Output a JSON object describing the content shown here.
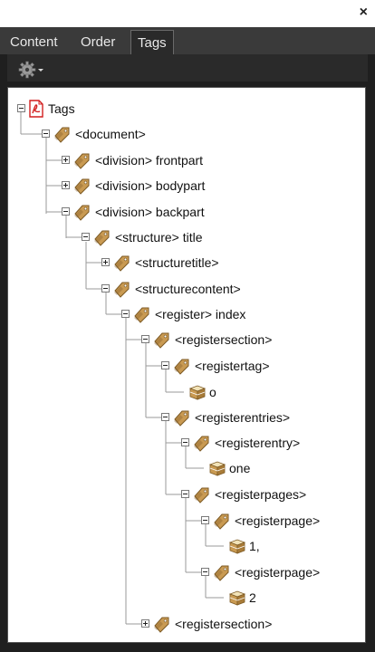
{
  "tabs": [
    {
      "label": "Content"
    },
    {
      "label": "Order"
    },
    {
      "label": "Tags"
    }
  ],
  "active_tab": "Tags",
  "close_glyph": "×",
  "tree": [
    {
      "label": "Tags",
      "icon": "pdf-icon",
      "exp": "minus"
    },
    {
      "label": "<document>",
      "icon": "tag-icon",
      "exp": "minus"
    },
    {
      "label": "<division> frontpart",
      "icon": "tag-icon",
      "exp": "plus"
    },
    {
      "label": "<division> bodypart",
      "icon": "tag-icon",
      "exp": "plus"
    },
    {
      "label": "<division> backpart",
      "icon": "tag-icon",
      "exp": "minus"
    },
    {
      "label": "<structure> title",
      "icon": "tag-icon",
      "exp": "minus"
    },
    {
      "label": "<structuretitle>",
      "icon": "tag-icon",
      "exp": "plus"
    },
    {
      "label": "<structurecontent>",
      "icon": "tag-icon",
      "exp": "minus"
    },
    {
      "label": "<register> index",
      "icon": "tag-icon",
      "exp": "minus"
    },
    {
      "label": "<registersection>",
      "icon": "tag-icon",
      "exp": "minus"
    },
    {
      "label": "<registertag>",
      "icon": "tag-icon",
      "exp": "minus"
    },
    {
      "label": "o",
      "icon": "content-box-icon",
      "exp": ""
    },
    {
      "label": "<registerentries>",
      "icon": "tag-icon",
      "exp": "minus"
    },
    {
      "label": "<registerentry>",
      "icon": "tag-icon",
      "exp": "minus"
    },
    {
      "label": "one",
      "icon": "content-box-icon",
      "exp": ""
    },
    {
      "label": "<registerpages>",
      "icon": "tag-icon",
      "exp": "minus"
    },
    {
      "label": "<registerpage>",
      "icon": "tag-icon",
      "exp": "minus"
    },
    {
      "label": "1,",
      "icon": "content-box-icon",
      "exp": ""
    },
    {
      "label": "<registerpage>",
      "icon": "tag-icon",
      "exp": "minus"
    },
    {
      "label": "2",
      "icon": "content-box-icon",
      "exp": ""
    },
    {
      "label": "<registersection>",
      "icon": "tag-icon",
      "exp": "plus"
    }
  ],
  "colors": {
    "tag_fill": "#c99a52",
    "tag_dark": "#7d5a24",
    "pdf_red": "#d21f1f"
  }
}
